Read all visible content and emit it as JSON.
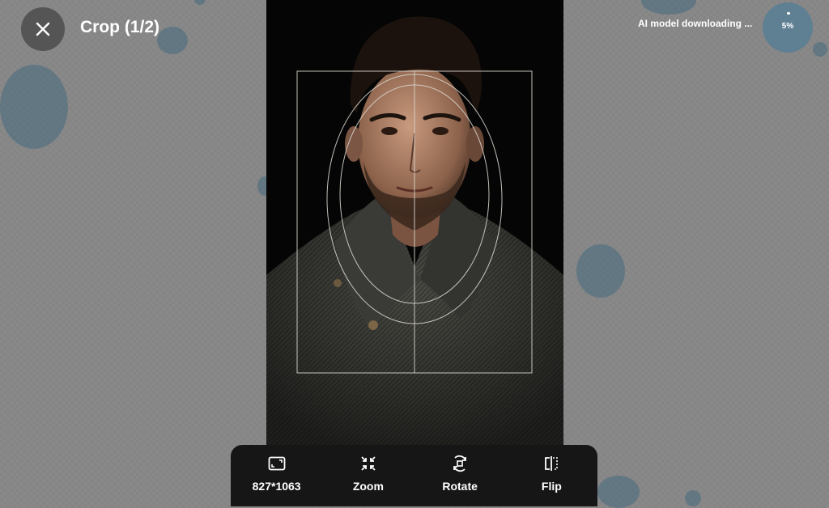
{
  "header": {
    "title": "Crop (1/2)",
    "close_icon": "close-icon"
  },
  "status": {
    "text": "AI model downloading ...",
    "progress_label": "5%",
    "progress_value": 0.05
  },
  "toolbar": {
    "items": [
      {
        "label": "827*1063",
        "icon": "aspect-ratio-icon"
      },
      {
        "label": "Zoom",
        "icon": "zoom-icon"
      },
      {
        "label": "Rotate",
        "icon": "rotate-icon"
      },
      {
        "label": "Flip",
        "icon": "flip-icon"
      }
    ]
  },
  "colors": {
    "background": "#858585",
    "toolbar": "#161616",
    "blob": "#46697d",
    "guide": "#d8d4cc"
  }
}
